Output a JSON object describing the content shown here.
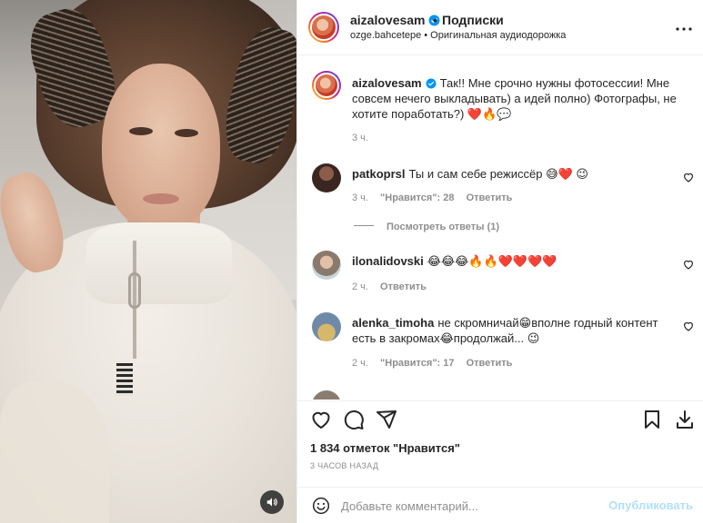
{
  "post": {
    "author": "aizalovesam",
    "follow_label": "Подписки",
    "separator": "•",
    "audio_author": "ozge.bahcetepe",
    "audio_separator": "•",
    "audio_title": "Оригинальная аудиодорожка",
    "caption": "Так!! Мне срочно нужны фотосессии! Мне совсем нечего выкладывать) а идей полно) Фотографы, не хотите поработать?) ❤️🔥💬",
    "caption_time": "3 ч.",
    "likes": "1 834 отметок \"Нравится\"",
    "posted": "3 ЧАСОВ НАЗАД"
  },
  "comments": [
    {
      "user": "patkoprsl",
      "text": "Ты и сам себе режиссёр 😅❤️ 😉",
      "time": "3 ч.",
      "likes": "\"Нравится\": 28",
      "reply": "Ответить",
      "view_replies": "Посмотреть ответы (1)"
    },
    {
      "user": "ilonalidovski",
      "text": "😂😂😂🔥🔥❤️❤️❤️❤️",
      "time": "2 ч.",
      "reply": "Ответить"
    },
    {
      "user": "alenka_timoha",
      "text": "не скромничай😁вполне годный контент есть в закромах😂продолжай... 😉",
      "time": "2 ч.",
      "likes": "\"Нравится\": 17",
      "reply": "Ответить"
    }
  ],
  "add_comment": {
    "placeholder": "Добавьте комментарий...",
    "publish_label": "Опубликовать"
  },
  "colors": {
    "verified": "#0095f6",
    "heart": "#ed4956",
    "publish_disabled": "#b2dffc"
  },
  "icons": {
    "like": "heart-icon",
    "comment": "comment-icon",
    "share": "share-icon",
    "save": "bookmark-icon",
    "download": "download-icon",
    "more": "more-horizontal-icon",
    "audio": "speaker-icon",
    "emoji": "smile-icon"
  }
}
